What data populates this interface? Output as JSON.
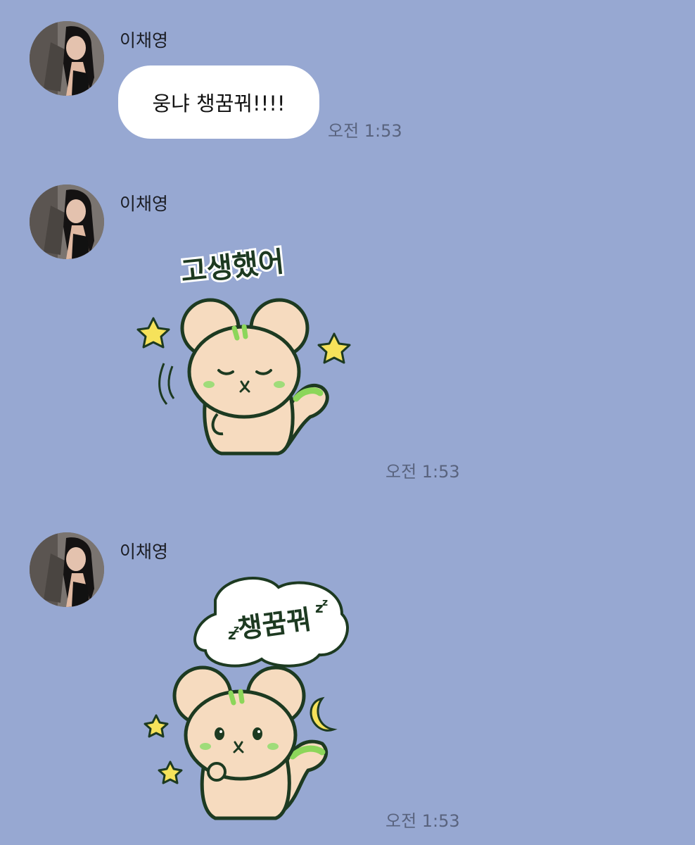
{
  "messages": [
    {
      "sender": "이채영",
      "type": "text",
      "text": "웅냐 챙꿈꿔!!!!",
      "time": "오전 1:53"
    },
    {
      "sender": "이채영",
      "type": "sticker",
      "sticker_text": "고생했어",
      "sticker_icon": "sleepy-mouse-sticker",
      "time": "오전 1:53"
    },
    {
      "sender": "이채영",
      "type": "sticker",
      "sticker_text": "챙꿈꿔",
      "sticker_icon": "goodnight-mouse-sticker",
      "time": "오전 1:53"
    }
  ],
  "colors": {
    "background": "#97a8d2",
    "bubble": "#ffffff",
    "time_text": "#59637e",
    "sticker_body": "#f6dbbf",
    "sticker_stripe": "#8cd65a",
    "sticker_outline": "#1d3a21",
    "star": "#f6e25a"
  }
}
